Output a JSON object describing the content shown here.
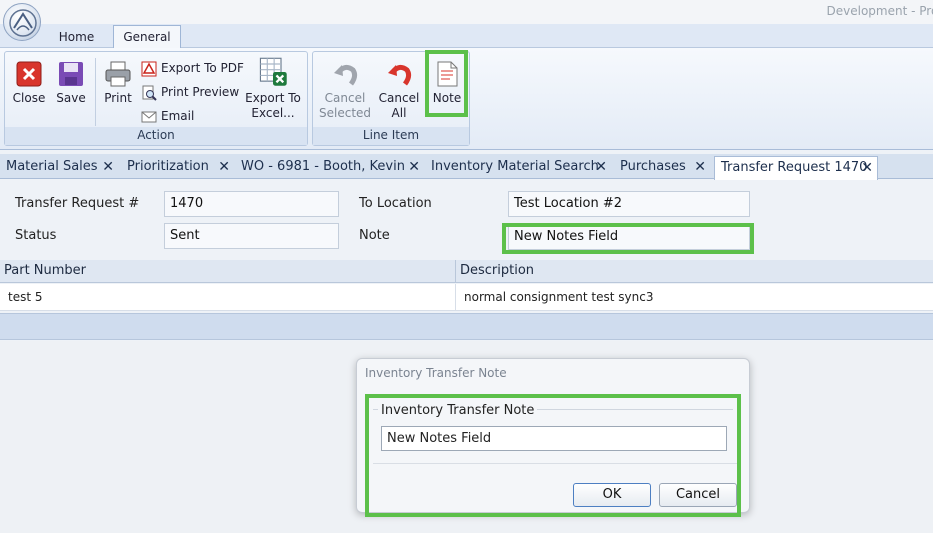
{
  "window": {
    "title": "Development - Prot"
  },
  "ribbon_tabs": [
    "Home",
    "General"
  ],
  "ribbon": {
    "action_group": {
      "label": "Action",
      "close": "Close",
      "save": "Save",
      "print": "Print",
      "export_pdf": "Export To PDF",
      "print_preview": "Print Preview",
      "email": "Email",
      "export_excel_1": "Export To",
      "export_excel_2": "Excel..."
    },
    "line_item_group": {
      "label": "Line Item",
      "cancel_selected_1": "Cancel",
      "cancel_selected_2": "Selected",
      "cancel_all_1": "Cancel",
      "cancel_all_2": "All",
      "note": "Note"
    }
  },
  "doc_tabs": [
    "Material Sales",
    "Prioritization",
    "WO - 6981 - Booth, Kevin",
    "Inventory Material Search",
    "Purchases",
    "Transfer Request 1470"
  ],
  "form": {
    "transfer_request_label": "Transfer Request #",
    "transfer_request_value": "1470",
    "status_label": "Status",
    "status_value": "Sent",
    "to_location_label": "To Location",
    "to_location_value": "Test Location #2",
    "note_label": "Note",
    "note_value": "New Notes Field"
  },
  "grid": {
    "columns": [
      "Part Number",
      "Description"
    ],
    "rows": [
      {
        "part_number": "test 5",
        "description": "normal consignment test sync3"
      }
    ]
  },
  "dialog": {
    "title": "Inventory Transfer Note",
    "group_label": "Inventory Transfer Note",
    "input_value": "New Notes Field",
    "ok": "OK",
    "cancel": "Cancel"
  },
  "colors": {
    "highlight": "#5cc04a",
    "accent": "#4d7fc2"
  }
}
